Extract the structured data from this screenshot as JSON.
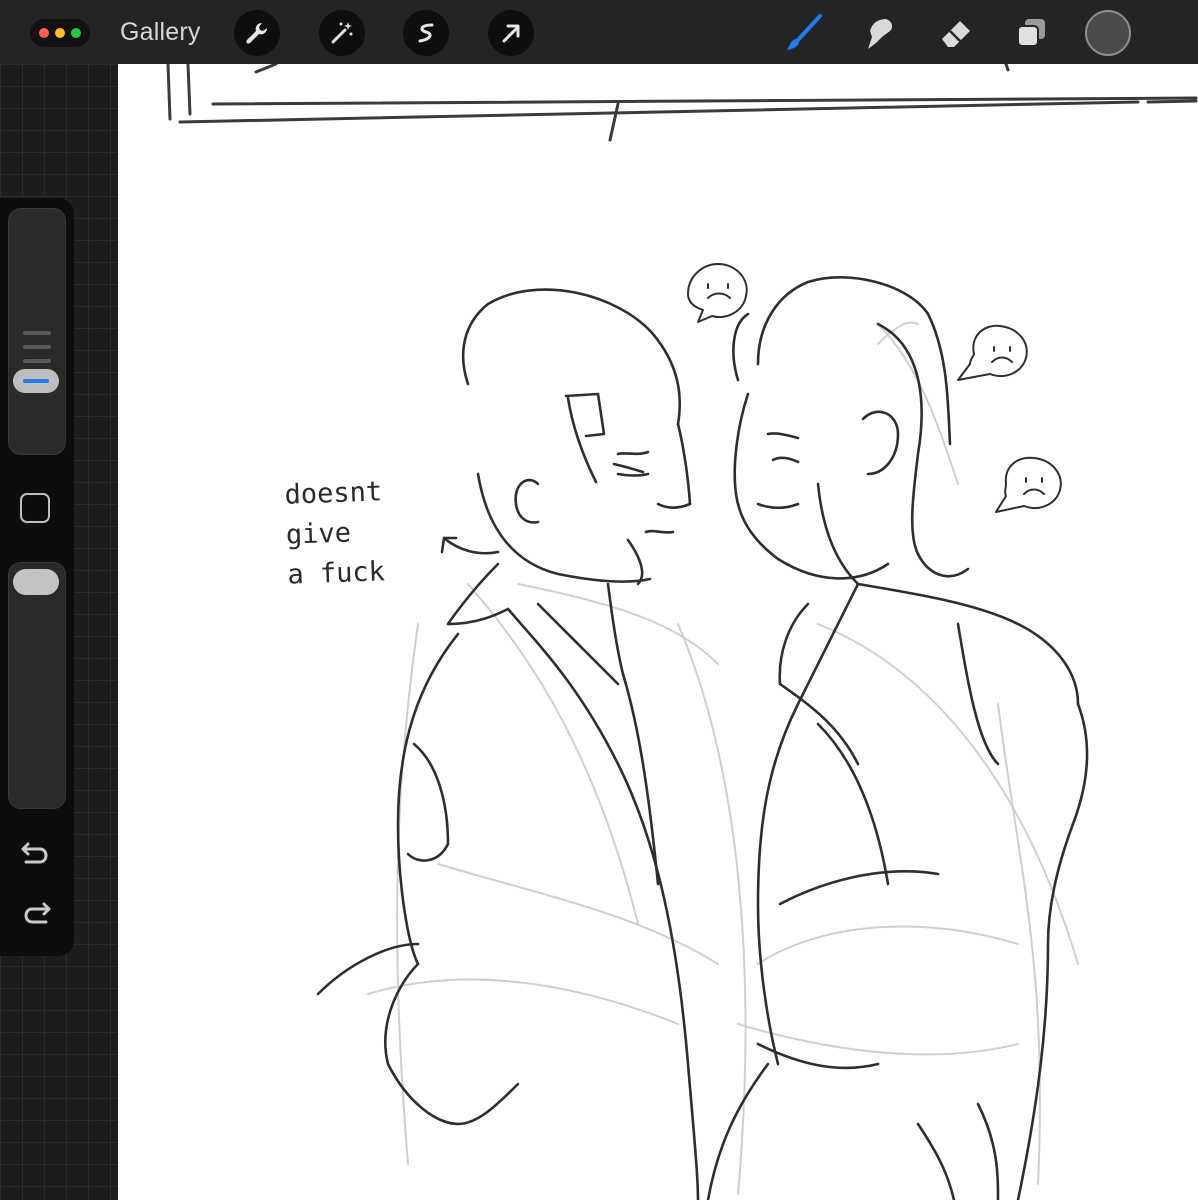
{
  "toolbar": {
    "gallery_label": "Gallery",
    "window_dot_colors": [
      "#ff5f57",
      "#febc2e",
      "#28c840"
    ],
    "left_tools": [
      "wrench-icon",
      "magic-wand-icon",
      "selection-icon",
      "move-arrow-icon"
    ],
    "right_tools": [
      "brush-icon",
      "smudge-icon",
      "eraser-icon",
      "layers-icon"
    ],
    "active_tool": "brush-icon",
    "accent_color": "#1e7bf0",
    "current_color": "#4a4a4c"
  },
  "sidebar": {
    "controls": [
      "brush-size-slider",
      "modify-button",
      "opacity-slider",
      "undo-button",
      "redo-button"
    ]
  },
  "canvas": {
    "annotation_lines": [
      "doesnt",
      "give",
      "a fuck"
    ],
    "emotes": [
      "frown-speech-bubble",
      "frown-speech-bubble",
      "frown-speech-bubble"
    ]
  }
}
